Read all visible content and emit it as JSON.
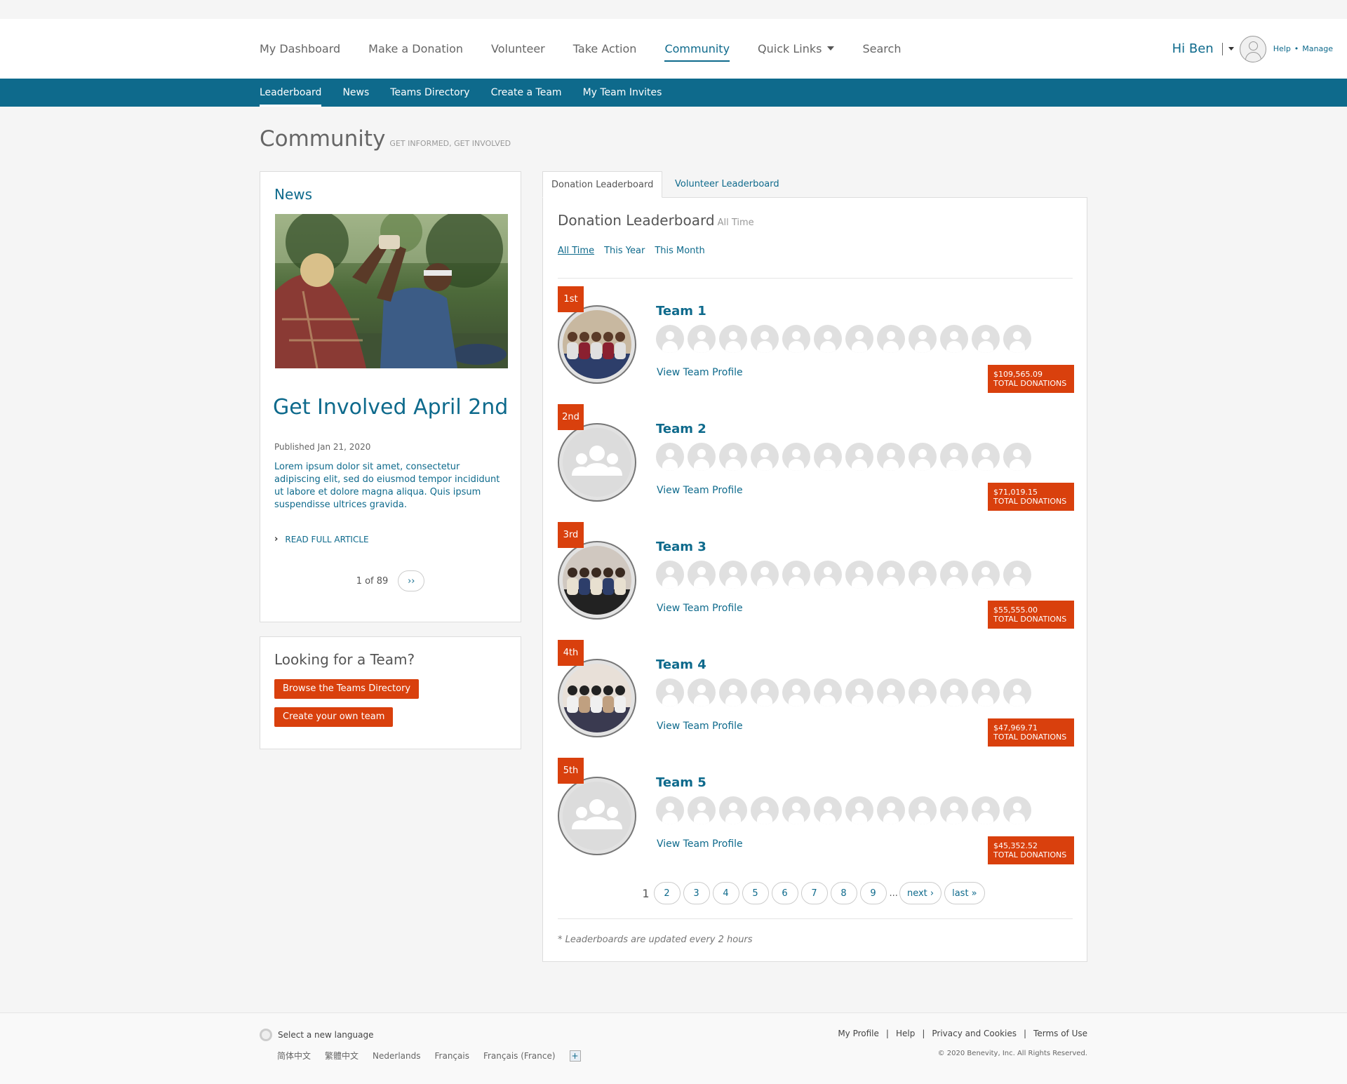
{
  "main_nav": [
    {
      "label": "My Dashboard",
      "active": false
    },
    {
      "label": "Make a Donation",
      "active": false
    },
    {
      "label": "Volunteer",
      "active": false
    },
    {
      "label": "Take Action",
      "active": false
    },
    {
      "label": "Community",
      "active": true
    },
    {
      "label": "Quick Links",
      "active": false,
      "dropdown": true
    },
    {
      "label": "Search",
      "active": false
    }
  ],
  "user": {
    "greeting": "Hi Ben",
    "help": "Help",
    "separator": "•",
    "manage": "Manage"
  },
  "sub_nav": [
    {
      "label": "Leaderboard",
      "active": true
    },
    {
      "label": "News",
      "active": false
    },
    {
      "label": "Teams Directory",
      "active": false
    },
    {
      "label": "Create a Team",
      "active": false
    },
    {
      "label": "My Team Invites",
      "active": false
    }
  ],
  "page": {
    "title": "Community",
    "subtitle": "Get informed, get involved"
  },
  "news": {
    "heading": "News",
    "title": "Get Involved April 2nd",
    "published": "Published Jan 21, 2020",
    "body": "Lorem ipsum dolor sit amet, consectetur adipiscing elit, sed do eiusmod tempor incididunt ut labore et dolore magna aliqua. Quis ipsum suspendisse ultrices gravida.",
    "read_more": "READ FULL ARTICLE",
    "pager_count": "1 of 89",
    "next": "››"
  },
  "find_team": {
    "heading": "Looking for a Team?",
    "browse_button": "Browse the Teams Directory",
    "create_button": "Create your own team"
  },
  "leaderboard": {
    "tabs": [
      {
        "label": "Donation Leaderboard",
        "active": true
      },
      {
        "label": "Volunteer Leaderboard",
        "active": false
      }
    ],
    "title": "Donation Leaderboard",
    "period": "All Time",
    "filters": [
      {
        "label": "All Time",
        "active": true
      },
      {
        "label": "This Year",
        "active": false
      },
      {
        "label": "This Month",
        "active": false
      }
    ],
    "view_label": "View Team Profile",
    "total_label": "TOTAL DONATIONS",
    "teams": [
      {
        "rank": "1st",
        "name": "Team 1",
        "total": "$109,565.09",
        "photo": "group-photo"
      },
      {
        "rank": "2nd",
        "name": "Team 2",
        "total": "$71,019.15",
        "photo": "placeholder"
      },
      {
        "rank": "3rd",
        "name": "Team 3",
        "total": "$55,555.00",
        "photo": "group-photo"
      },
      {
        "rank": "4th",
        "name": "Team 4",
        "total": "$47,969.71",
        "photo": "group-photo"
      },
      {
        "rank": "5th",
        "name": "Team 5",
        "total": "$45,352.52",
        "photo": "placeholder"
      }
    ],
    "pager": {
      "current": "1",
      "pages": [
        "2",
        "3",
        "4",
        "5",
        "6",
        "7",
        "8",
        "9"
      ],
      "ellipsis": "...",
      "next": "next ›",
      "last": "last »"
    },
    "footnote": "* Leaderboards are updated every 2 hours"
  },
  "footer": {
    "language_label": "Select a new language",
    "languages": [
      "简体中文",
      "繁體中文",
      "Nederlands",
      "Français",
      "Français (France)"
    ],
    "more_languages": "+",
    "links": [
      "My Profile",
      "Help",
      "Privacy and Cookies",
      "Terms of Use"
    ],
    "link_separator": "|",
    "copyright": "© 2020 Benevity, Inc. All Rights Reserved."
  },
  "colors": {
    "brand_blue": "#0e6a8c",
    "accent_orange": "#d9400d"
  }
}
